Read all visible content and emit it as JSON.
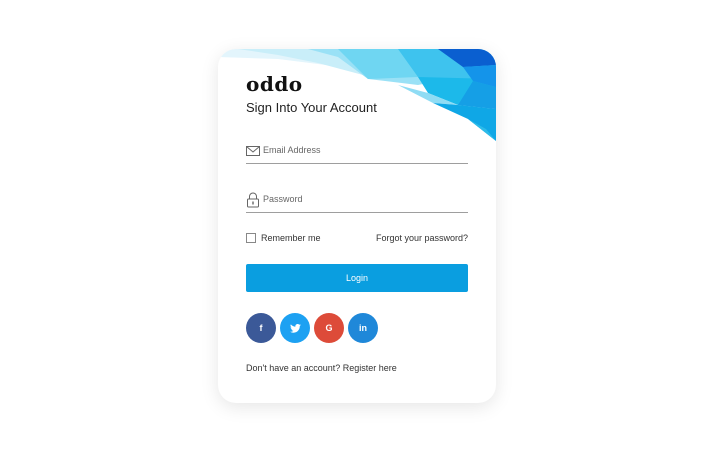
{
  "brand": {
    "logo": "oddo"
  },
  "form": {
    "title": "Sign Into Your Account",
    "email_placeholder": "Email Address",
    "password_placeholder": "Password",
    "remember_label": "Remember me",
    "forgot_label": "Forgot your password?",
    "login_label": "Login",
    "register_text": "Don't have an account? Register here"
  },
  "social": {
    "facebook": {
      "glyph": "f",
      "icon": "facebook-icon",
      "color": "#3b5998"
    },
    "twitter": {
      "glyph": "t",
      "icon": "twitter-icon",
      "color": "#1da1f2"
    },
    "google": {
      "glyph": "G",
      "icon": "google-icon",
      "color": "#dd4b39"
    },
    "linkedin": {
      "glyph": "in",
      "icon": "linkedin-icon",
      "color": "#1f88d9"
    }
  },
  "colors": {
    "accent": "#0a9ee0",
    "header_art": [
      "#0a5fd0",
      "#1494ea",
      "#1cb9ea",
      "#6fd6f2",
      "#c9eef9"
    ]
  }
}
